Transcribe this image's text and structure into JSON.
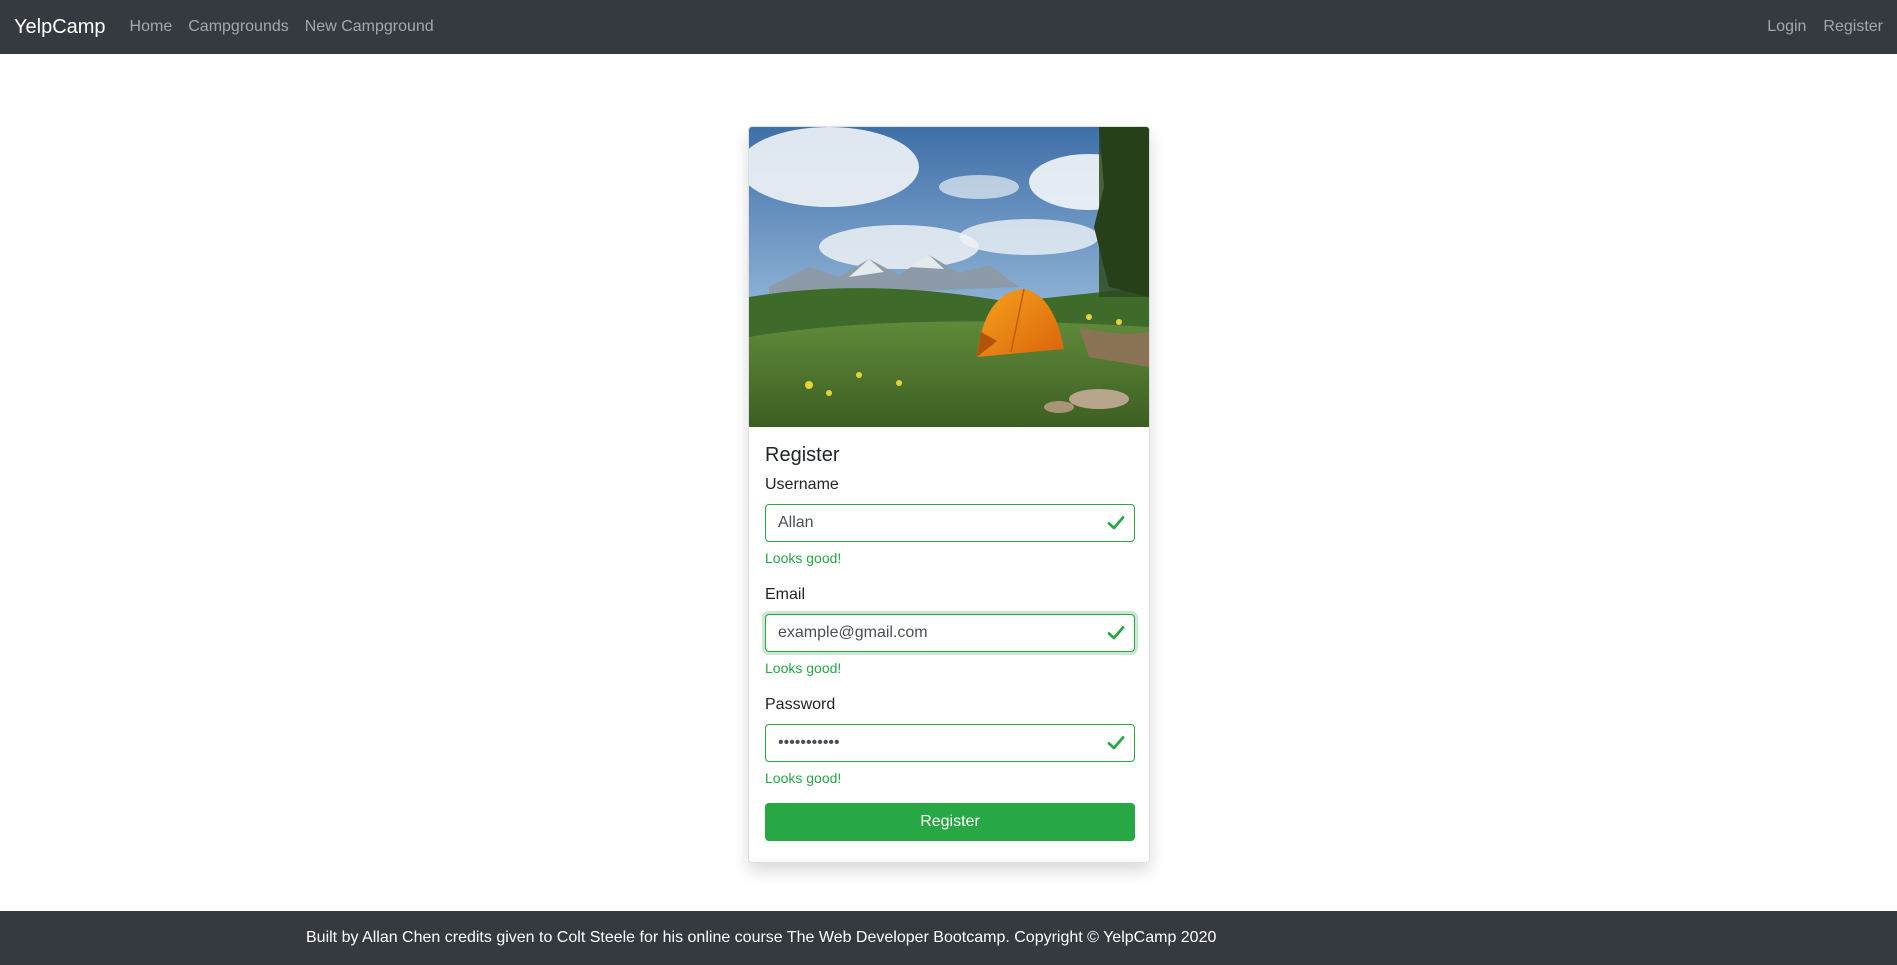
{
  "navbar": {
    "brand": "YelpCamp",
    "links": [
      "Home",
      "Campgrounds",
      "New Campground"
    ],
    "right_links": [
      "Login",
      "Register"
    ]
  },
  "register_card": {
    "image": "campsite-tent-photo",
    "title": "Register",
    "fields": [
      {
        "label": "Username",
        "value": "Allan",
        "feedback": "Looks good!"
      },
      {
        "label": "Email",
        "value": "example@gmail.com",
        "feedback": "Looks good!"
      },
      {
        "label": "Password",
        "value": "•••••••••••",
        "feedback": "Looks good!"
      }
    ],
    "submit_label": "Register"
  },
  "footer": {
    "text": "Built by Allan Chen credits given to Colt Steele for his online course The Web Developer Bootcamp. Copyright © YelpCamp 2020"
  },
  "colors": {
    "navbar_bg": "#343a40",
    "success": "#28a745"
  },
  "icons": {
    "valid_field": "check-icon"
  }
}
